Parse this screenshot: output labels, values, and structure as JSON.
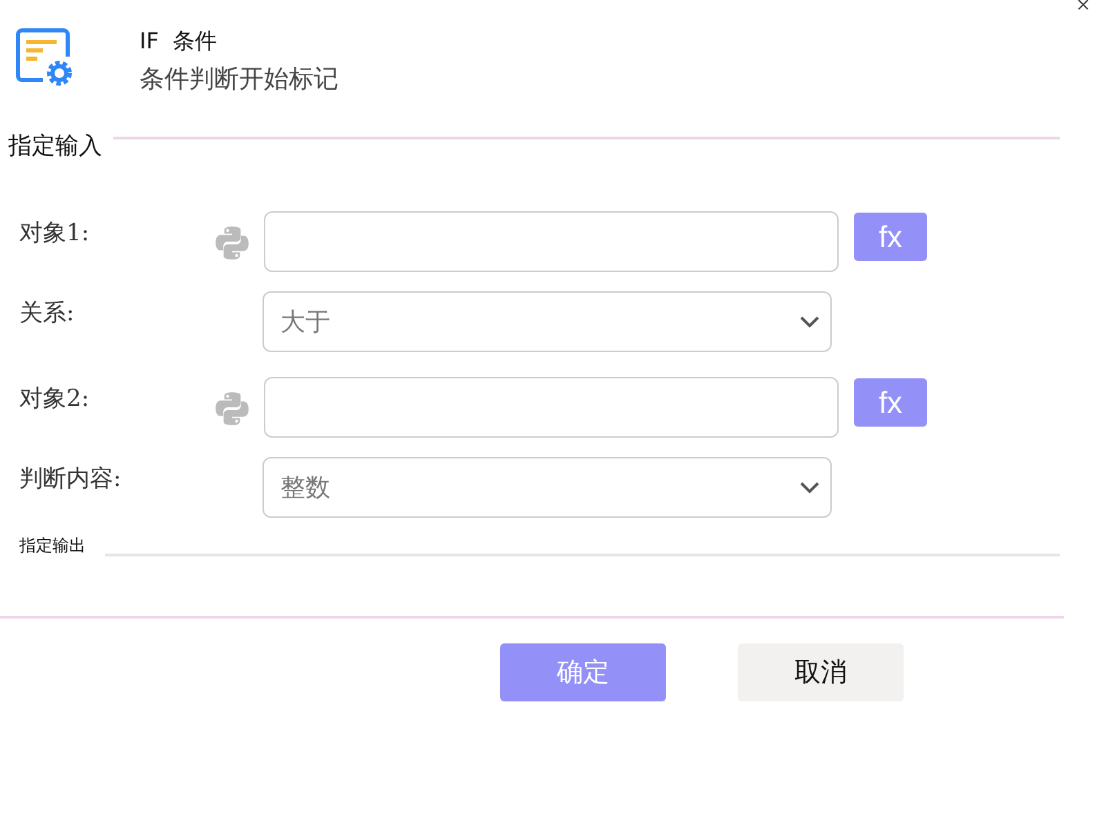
{
  "header": {
    "title": "IF  条件",
    "subtitle": "条件判断开始标记"
  },
  "input_section": {
    "title": "指定输入",
    "rows": [
      {
        "kind": "expression",
        "label": "对象1:",
        "fx": "fx"
      },
      {
        "kind": "select",
        "label": "关系:",
        "value": "大于"
      },
      {
        "kind": "expression",
        "label": "对象2:",
        "fx": "fx"
      },
      {
        "kind": "select",
        "label": "判断内容:",
        "value": "整数"
      }
    ]
  },
  "output_section": {
    "title": "指定输出"
  },
  "buttons": [
    {
      "kind": "primary",
      "label": "确定"
    },
    {
      "kind": "secondary",
      "label": "取消"
    }
  ]
}
